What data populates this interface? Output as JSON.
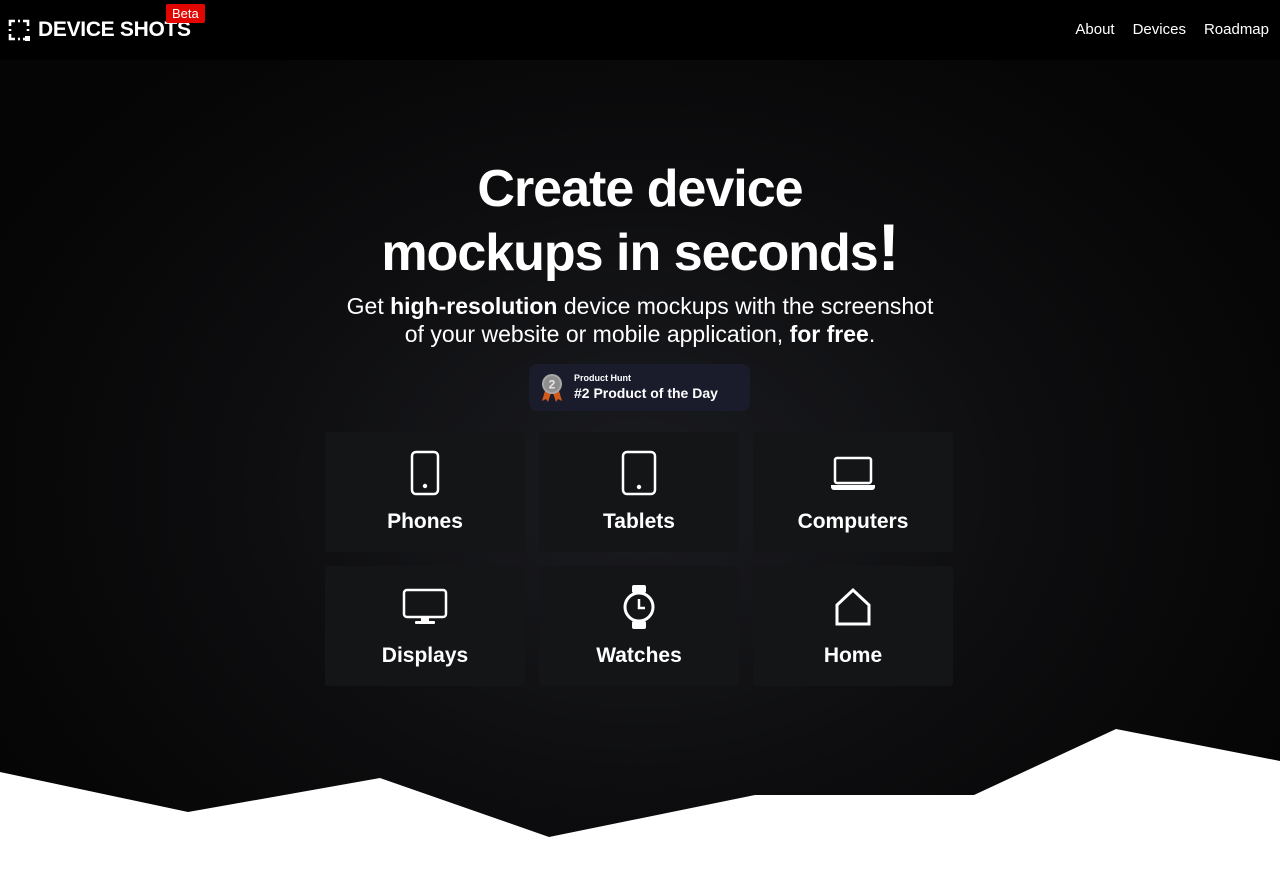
{
  "brand": {
    "name": "DEVICE SHOTS",
    "badge": "Beta"
  },
  "nav": {
    "items": [
      {
        "label": "About"
      },
      {
        "label": "Devices"
      },
      {
        "label": "Roadmap"
      }
    ]
  },
  "hero": {
    "headline_line1": "Create device",
    "headline_line2": "mockups in seconds",
    "headline_bang": "!",
    "sub_line1_a": "Get ",
    "sub_line1_b": "high-resolution",
    "sub_line1_c": " device mockups with the screenshot",
    "sub_line2_a": "of your website or mobile application, ",
    "sub_line2_b": "for free",
    "sub_line2_c": "."
  },
  "product_hunt": {
    "medal_number": "2",
    "label": "Product Hunt",
    "title": "#2 Product of the Day"
  },
  "categories": [
    {
      "label": "Phones",
      "icon": "phone-icon"
    },
    {
      "label": "Tablets",
      "icon": "tablet-icon"
    },
    {
      "label": "Computers",
      "icon": "laptop-icon"
    },
    {
      "label": "Displays",
      "icon": "monitor-icon"
    },
    {
      "label": "Watches",
      "icon": "watch-icon"
    },
    {
      "label": "Home",
      "icon": "home-icon"
    }
  ],
  "colors": {
    "background": "#050505",
    "card": "#141517",
    "badge_red": "#e10600",
    "ph_badge": "#1a1c2c",
    "medal_silver": "#a8a8a8",
    "medal_ribbon": "#d35a1c"
  }
}
